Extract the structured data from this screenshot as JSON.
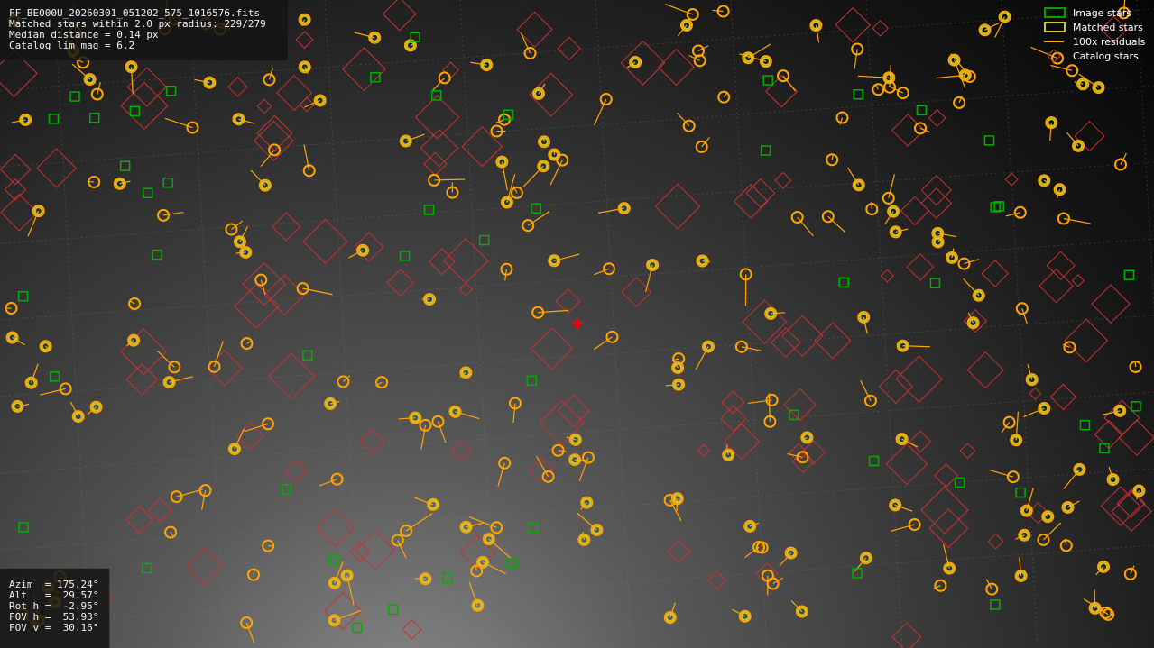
{
  "window": {
    "filename": "FF_BE000U_20260301_051202_575_1016576.fits"
  },
  "info_top": {
    "line1": "Matched stars within 2.0 px radius: 229/279",
    "line2": "Median distance = 0.14 px",
    "line3": "Catalog lim mag = 6.2"
  },
  "info_bottom": {
    "azim": "Azim  = 175.24°",
    "alt": "Alt   =  29.57°",
    "rot": "Rot h =  -2.95°",
    "fovh": "FOV h =  53.93°",
    "fovv": "FOV v =  30.16°"
  },
  "legend": {
    "image_stars": "Image stars",
    "matched_stars": "Matched stars",
    "residuals": "100x residuals",
    "catalog_stars": "Catalog stars"
  },
  "colors": {
    "image_star": "#00b000",
    "matched_star": "#c8c832",
    "residual": "#ffa500",
    "catalog_star": "#c83232",
    "center_marker": "#ff0000"
  }
}
